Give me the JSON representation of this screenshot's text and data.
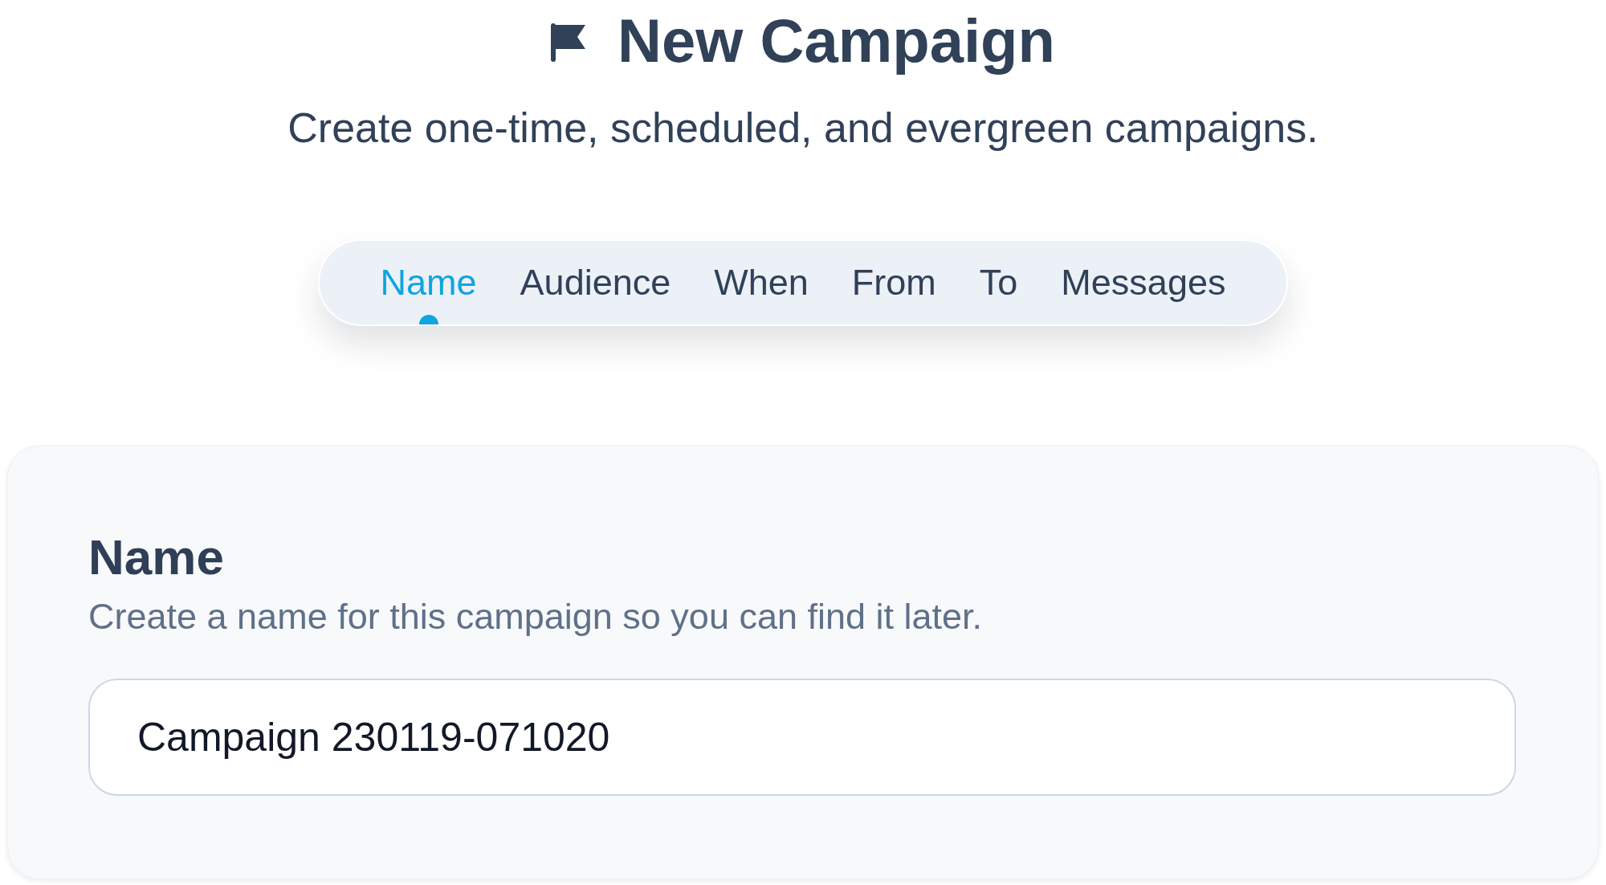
{
  "header": {
    "title": "New Campaign",
    "subtitle": "Create one-time, scheduled, and evergreen campaigns."
  },
  "tabs": [
    {
      "label": "Name",
      "selected": true
    },
    {
      "label": "Audience",
      "selected": false
    },
    {
      "label": "When",
      "selected": false
    },
    {
      "label": "From",
      "selected": false
    },
    {
      "label": "To",
      "selected": false
    },
    {
      "label": "Messages",
      "selected": false
    }
  ],
  "section": {
    "heading": "Name",
    "description": "Create a name for this campaign so you can find it later.",
    "name_field": {
      "value": "Campaign 230119-071020"
    }
  }
}
